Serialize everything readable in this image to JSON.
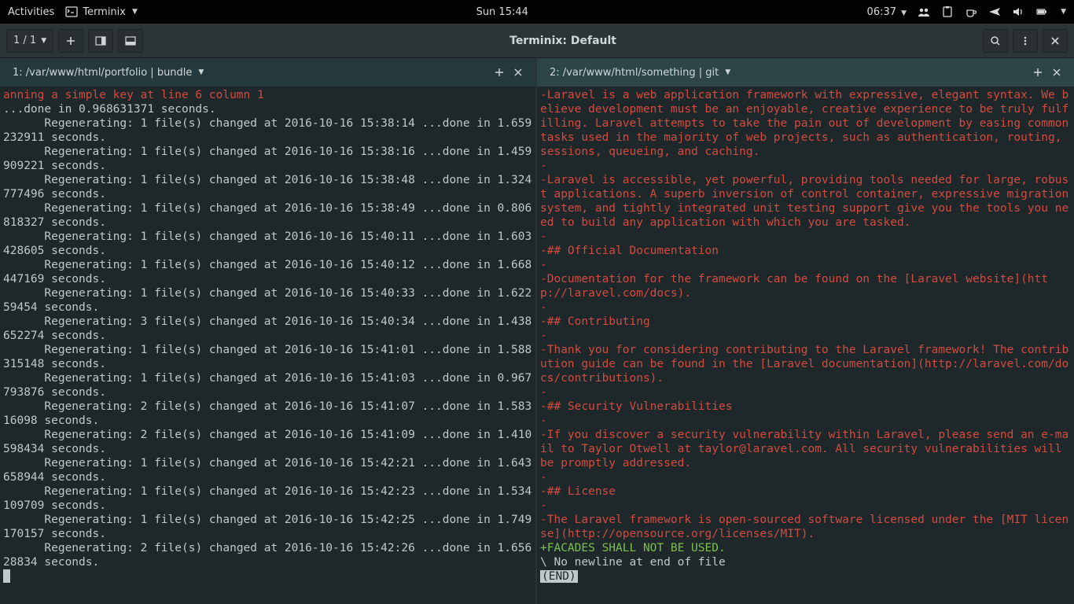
{
  "gnome": {
    "activities": "Activities",
    "app_name": "Terminix",
    "clock_center": "Sun 15:44",
    "clock_right": "06:37"
  },
  "header": {
    "session_counter": "1 / 1",
    "title": "Terminix: Default"
  },
  "panes": {
    "left": {
      "tab_title": "1: /var/www/html/portfolio | bundle",
      "lines": [
        {
          "cls": "red",
          "text": "anning a simple key at line 6 column 1"
        },
        {
          "cls": "",
          "text": "...done in 0.968631371 seconds."
        },
        {
          "cls": "",
          "text": "      Regenerating: 1 file(s) changed at 2016-10-16 15:38:14 ...done in 1.659232911 seconds."
        },
        {
          "cls": "",
          "text": "      Regenerating: 1 file(s) changed at 2016-10-16 15:38:16 ...done in 1.459909221 seconds."
        },
        {
          "cls": "",
          "text": "      Regenerating: 1 file(s) changed at 2016-10-16 15:38:48 ...done in 1.324777496 seconds."
        },
        {
          "cls": "",
          "text": "      Regenerating: 1 file(s) changed at 2016-10-16 15:38:49 ...done in 0.806818327 seconds."
        },
        {
          "cls": "",
          "text": "      Regenerating: 1 file(s) changed at 2016-10-16 15:40:11 ...done in 1.603428605 seconds."
        },
        {
          "cls": "",
          "text": "      Regenerating: 1 file(s) changed at 2016-10-16 15:40:12 ...done in 1.668447169 seconds."
        },
        {
          "cls": "",
          "text": "      Regenerating: 1 file(s) changed at 2016-10-16 15:40:33 ...done in 1.62259454 seconds."
        },
        {
          "cls": "",
          "text": "      Regenerating: 3 file(s) changed at 2016-10-16 15:40:34 ...done in 1.438652274 seconds."
        },
        {
          "cls": "",
          "text": "      Regenerating: 1 file(s) changed at 2016-10-16 15:41:01 ...done in 1.588315148 seconds."
        },
        {
          "cls": "",
          "text": "      Regenerating: 1 file(s) changed at 2016-10-16 15:41:03 ...done in 0.967793876 seconds."
        },
        {
          "cls": "",
          "text": "      Regenerating: 2 file(s) changed at 2016-10-16 15:41:07 ...done in 1.58316098 seconds."
        },
        {
          "cls": "",
          "text": "      Regenerating: 2 file(s) changed at 2016-10-16 15:41:09 ...done in 1.410598434 seconds."
        },
        {
          "cls": "",
          "text": "      Regenerating: 1 file(s) changed at 2016-10-16 15:42:21 ...done in 1.643658944 seconds."
        },
        {
          "cls": "",
          "text": "      Regenerating: 1 file(s) changed at 2016-10-16 15:42:23 ...done in 1.534109709 seconds."
        },
        {
          "cls": "",
          "text": "      Regenerating: 1 file(s) changed at 2016-10-16 15:42:25 ...done in 1.749170157 seconds."
        },
        {
          "cls": "",
          "text": "      Regenerating: 2 file(s) changed at 2016-10-16 15:42:26 ...done in 1.65628834 seconds."
        }
      ]
    },
    "right": {
      "tab_title": "2: /var/www/html/something | git",
      "lines": [
        {
          "cls": "red",
          "text": "-Laravel is a web application framework with expressive, elegant syntax. We believe development must be an enjoyable, creative experience to be truly fulfilling. Laravel attempts to take the pain out of development by easing common tasks used in the majority of web projects, such as authentication, routing, sessions, queueing, and caching."
        },
        {
          "cls": "red",
          "text": "-"
        },
        {
          "cls": "red",
          "text": "-Laravel is accessible, yet powerful, providing tools needed for large, robust applications. A superb inversion of control container, expressive migration system, and tightly integrated unit testing support give you the tools you need to build any application with which you are tasked."
        },
        {
          "cls": "red",
          "text": "-"
        },
        {
          "cls": "red",
          "text": "-## Official Documentation"
        },
        {
          "cls": "red",
          "text": "-"
        },
        {
          "cls": "red",
          "text": "-Documentation for the framework can be found on the [Laravel website](http://laravel.com/docs)."
        },
        {
          "cls": "red",
          "text": "-"
        },
        {
          "cls": "red",
          "text": "-## Contributing"
        },
        {
          "cls": "red",
          "text": "-"
        },
        {
          "cls": "red",
          "text": "-Thank you for considering contributing to the Laravel framework! The contribution guide can be found in the [Laravel documentation](http://laravel.com/docs/contributions)."
        },
        {
          "cls": "red",
          "text": "-"
        },
        {
          "cls": "red",
          "text": "-## Security Vulnerabilities"
        },
        {
          "cls": "red",
          "text": "-"
        },
        {
          "cls": "red",
          "text": "-If you discover a security vulnerability within Laravel, please send an e-mail to Taylor Otwell at taylor@laravel.com. All security vulnerabilities will be promptly addressed."
        },
        {
          "cls": "red",
          "text": "-"
        },
        {
          "cls": "red",
          "text": "-## License"
        },
        {
          "cls": "red",
          "text": "-"
        },
        {
          "cls": "red",
          "text": "-The Laravel framework is open-sourced software licensed under the [MIT license](http://opensource.org/licenses/MIT)."
        },
        {
          "cls": "green",
          "text": "+FACADES SHALL NOT BE USED."
        },
        {
          "cls": "",
          "text": "\\ No newline at end of file"
        }
      ],
      "end_marker": "(END)"
    }
  }
}
